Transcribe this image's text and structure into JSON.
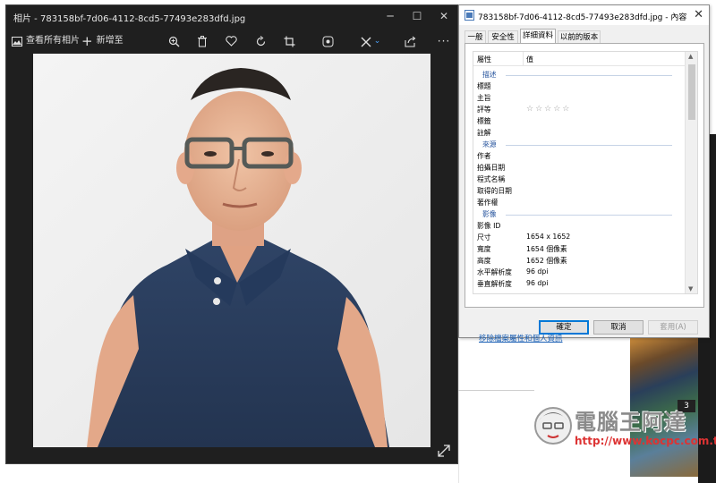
{
  "photos_window": {
    "title": "相片 - 783158bf-7d06-4112-8cd5-77493e283dfd.jpg",
    "toolbar": {
      "see_all": "查看所有相片",
      "add_to": "新增至"
    },
    "icons": [
      "minimize-icon",
      "maximize-icon",
      "close-icon",
      "gallery-icon",
      "plus-icon",
      "zoom-icon",
      "delete-icon",
      "favorite-icon",
      "rotate-icon",
      "crop-icon",
      "enhance-icon",
      "edit-icon",
      "share-icon",
      "more-icon",
      "fullscreen-icon"
    ]
  },
  "properties_dialog": {
    "title": "783158bf-7d06-4112-8cd5-77493e283dfd.jpg - 內容",
    "tabs": [
      {
        "label": "一般",
        "active": false
      },
      {
        "label": "安全性",
        "active": false
      },
      {
        "label": "詳細資料",
        "active": true
      },
      {
        "label": "以前的版本",
        "active": false
      }
    ],
    "table": {
      "header_property": "屬性",
      "header_value": "值",
      "rows": [
        {
          "type": "section",
          "label": "描述"
        },
        {
          "type": "prop",
          "label": "標題",
          "value": ""
        },
        {
          "type": "prop",
          "label": "主旨",
          "value": ""
        },
        {
          "type": "prop",
          "label": "評等",
          "value": "☆☆☆☆☆"
        },
        {
          "type": "prop",
          "label": "標籤",
          "value": ""
        },
        {
          "type": "prop",
          "label": "註解",
          "value": ""
        },
        {
          "type": "section",
          "label": "來源"
        },
        {
          "type": "prop",
          "label": "作者",
          "value": ""
        },
        {
          "type": "prop",
          "label": "拍攝日期",
          "value": ""
        },
        {
          "type": "prop",
          "label": "程式名稱",
          "value": ""
        },
        {
          "type": "prop",
          "label": "取得的日期",
          "value": ""
        },
        {
          "type": "prop",
          "label": "著作權",
          "value": ""
        },
        {
          "type": "section",
          "label": "影像"
        },
        {
          "type": "prop",
          "label": "影像 ID",
          "value": ""
        },
        {
          "type": "prop",
          "label": "尺寸",
          "value": "1654 x 1652"
        },
        {
          "type": "prop",
          "label": "寬度",
          "value": "1654 個像素"
        },
        {
          "type": "prop",
          "label": "高度",
          "value": "1652 個像素"
        },
        {
          "type": "prop",
          "label": "水平解析度",
          "value": "96 dpi"
        },
        {
          "type": "prop",
          "label": "垂直解析度",
          "value": "96 dpi"
        }
      ]
    },
    "remove_link": "移除檔案屬性和個人資訊",
    "buttons": {
      "ok": "確定",
      "cancel": "取消",
      "apply": "套用(A)"
    }
  },
  "background": {
    "badge": "3",
    "watermark_title": "電腦王阿達",
    "watermark_url": "http://www.kocpc.com.tw"
  },
  "colors": {
    "photos_bg": "#1f1f1f",
    "dialog_bg": "#f0f0f0",
    "link": "#1a5fb4",
    "section_text": "#1f4e9a",
    "focus_border": "#0078d7"
  }
}
